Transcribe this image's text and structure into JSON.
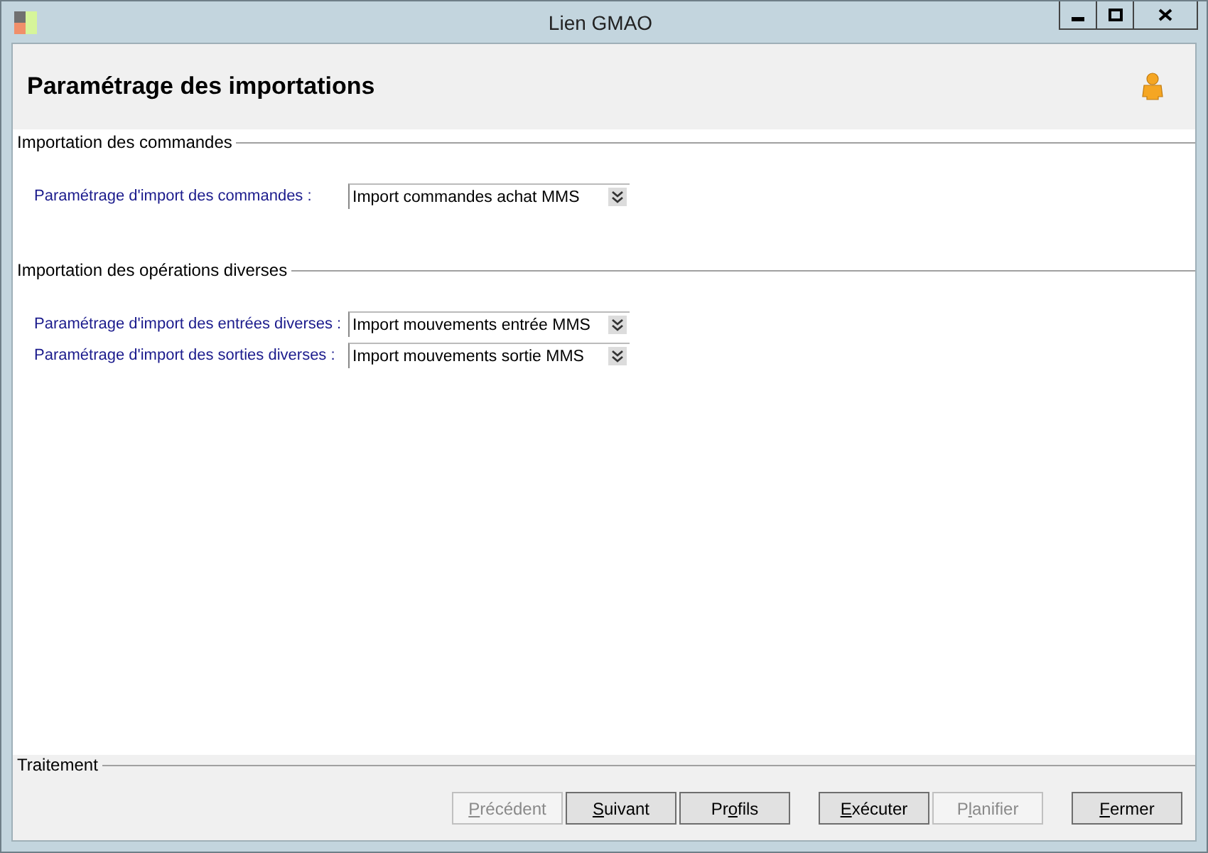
{
  "window": {
    "title": "Lien GMAO"
  },
  "header": {
    "title": "Paramétrage des importations"
  },
  "sections": [
    {
      "title": "Importation des commandes",
      "fields": [
        {
          "label": "Paramétrage d'import des commandes :",
          "value": "Import commandes achat MMS"
        }
      ]
    },
    {
      "title": "Importation des opérations diverses",
      "fields": [
        {
          "label": "Paramétrage d'import des entrées diverses :",
          "value": "Import mouvements entrée MMS"
        },
        {
          "label": "Paramétrage d'import des sorties diverses :",
          "value": "Import mouvements sortie MMS"
        }
      ]
    }
  ],
  "footer": {
    "title": "Traitement",
    "buttons": [
      {
        "key": "P",
        "after": "récédent",
        "disabled": true
      },
      {
        "key": "S",
        "after": "uivant",
        "disabled": false
      },
      {
        "before": "Pr",
        "key": "o",
        "after": "fils",
        "disabled": false
      },
      {
        "key": "E",
        "after": "xécuter",
        "disabled": false
      },
      {
        "before": "P",
        "key": "l",
        "after": "anifier",
        "disabled": true
      },
      {
        "key": "F",
        "after": "ermer",
        "disabled": false
      }
    ]
  }
}
